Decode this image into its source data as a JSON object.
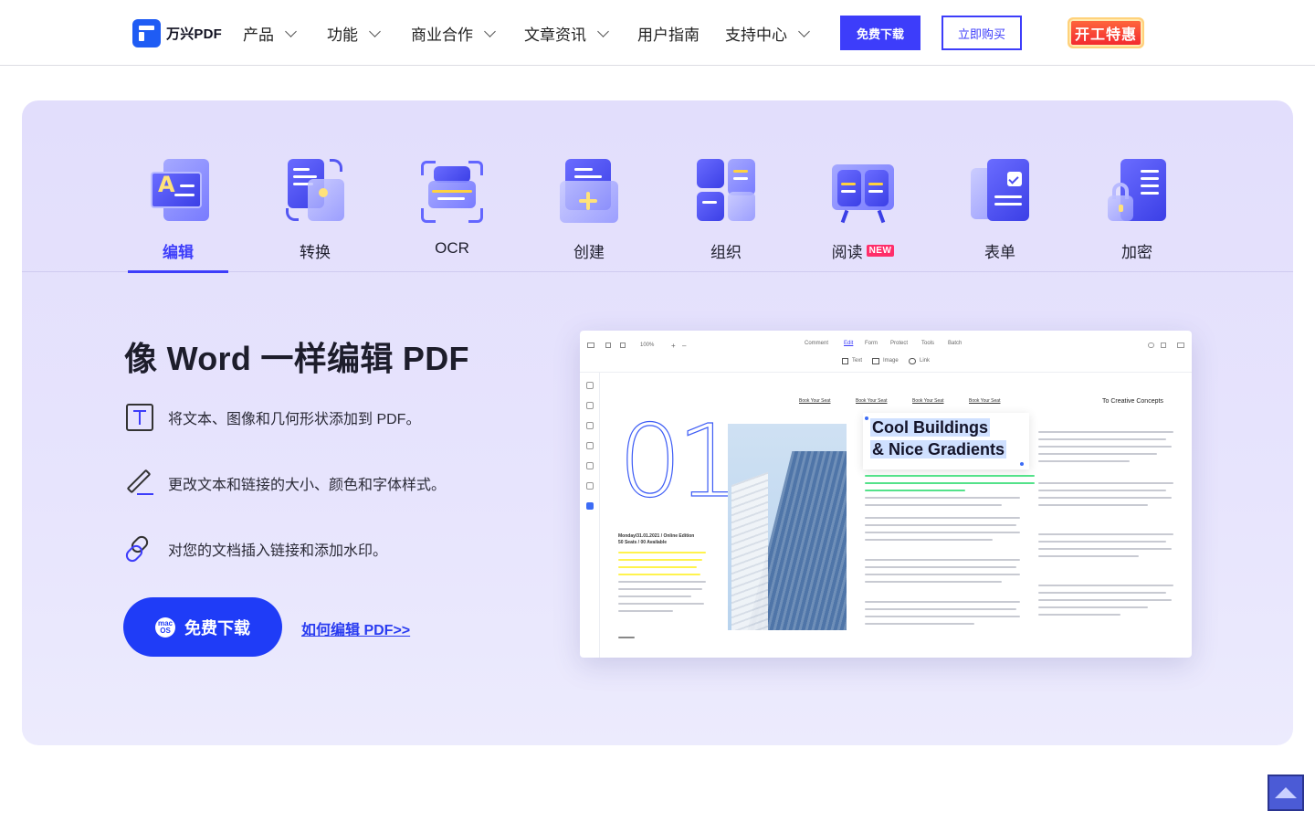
{
  "nav": {
    "logo_text": "万兴PDF",
    "items": [
      {
        "label": "产品",
        "has_dropdown": true
      },
      {
        "label": "功能",
        "has_dropdown": true
      },
      {
        "label": "商业合作",
        "has_dropdown": true
      },
      {
        "label": "文章资讯",
        "has_dropdown": true
      },
      {
        "label": "用户指南",
        "has_dropdown": false
      },
      {
        "label": "支持中心",
        "has_dropdown": true
      }
    ],
    "download_label": "免费下载",
    "buy_label": "立即购买",
    "promo_label": "开工特惠"
  },
  "tabs": [
    {
      "label": "编辑",
      "icon": "edit-icon",
      "active": true
    },
    {
      "label": "转换",
      "icon": "convert-icon",
      "active": false
    },
    {
      "label": "OCR",
      "icon": "ocr-icon",
      "active": false
    },
    {
      "label": "创建",
      "icon": "create-icon",
      "active": false
    },
    {
      "label": "组织",
      "icon": "organize-icon",
      "active": false
    },
    {
      "label": "阅读",
      "icon": "read-icon",
      "active": false,
      "badge": "NEW"
    },
    {
      "label": "表单",
      "icon": "form-icon",
      "active": false
    },
    {
      "label": "加密",
      "icon": "encrypt-icon",
      "active": false
    }
  ],
  "hero": {
    "title": "像 Word 一样编辑 PDF",
    "features": [
      {
        "icon": "text-box-icon",
        "text": "将文本、图像和几何形状添加到 PDF。"
      },
      {
        "icon": "pen-edit-icon",
        "text": "更改文本和链接的大小、颜色和字体样式。"
      },
      {
        "icon": "link-icon",
        "text": "对您的文档插入链接和添加水印。"
      }
    ],
    "cta_label": "免费下载",
    "cta_os_label": "mac OS",
    "howto_label": "如何编辑 PDF>>"
  },
  "screenshot": {
    "zoom": "100%",
    "menu": [
      "Comment",
      "Edit",
      "Form",
      "Protect",
      "Tools",
      "Batch"
    ],
    "active_menu": "Edit",
    "edit_tools": [
      "Text",
      "Image",
      "Link"
    ],
    "doc_links": [
      "Book Your Seat",
      "Book Your Seat",
      "Book Your Seat",
      "Book Your Seat"
    ],
    "doc_header_right": "To Creative Concepts",
    "big_number": "01",
    "heading_line1": "Cool Buildings",
    "heading_line2": "& Nice Gradients",
    "event_line1": "Monday/31.01.2021 / Online Edition",
    "event_line2": "50 Seats / 00 Available"
  },
  "colors": {
    "accent": "#3d3dfa",
    "cta": "#1f3cf7",
    "panel_bg": "#e4e0fc",
    "promo": "#f2262f",
    "new_badge": "#ff2e6a"
  }
}
